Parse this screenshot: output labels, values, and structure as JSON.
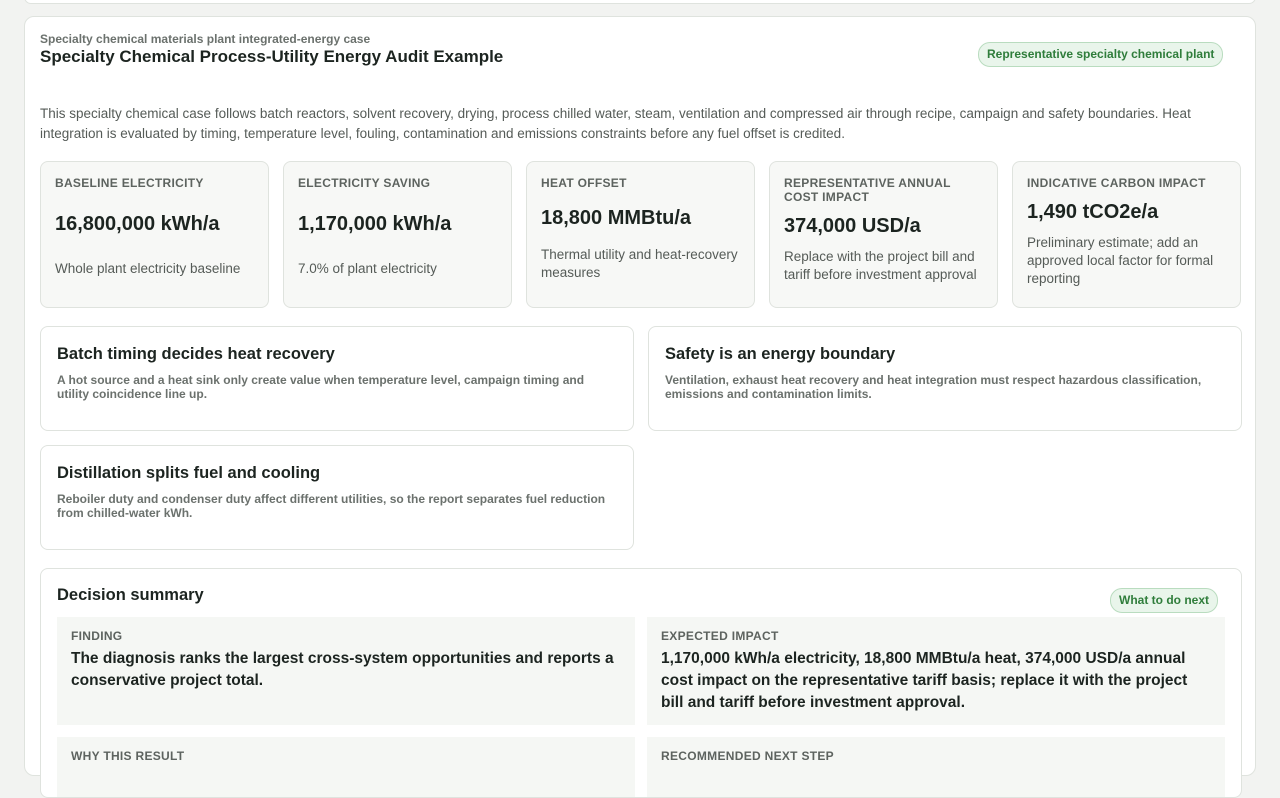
{
  "header": {
    "eyebrow": "Specialty chemical materials plant integrated-energy case",
    "title": "Specialty Chemical Process-Utility Energy Audit Example",
    "badge": "Representative specialty chemical plant"
  },
  "intro": "This specialty chemical case follows batch reactors, solvent recovery, drying, process chilled water, steam, ventilation and compressed air through recipe, campaign and safety boundaries. Heat integration is evaluated by timing, temperature level, fouling, contamination and emissions constraints before any fuel offset is credited.",
  "metrics": [
    {
      "label": "BASELINE ELECTRICITY",
      "value": "16,800,000 kWh/a",
      "desc": "Whole plant electricity baseline"
    },
    {
      "label": "ELECTRICITY SAVING",
      "value": "1,170,000 kWh/a",
      "desc": "7.0% of plant electricity"
    },
    {
      "label": "HEAT OFFSET",
      "value": "18,800 MMBtu/a",
      "desc": "Thermal utility and heat-recovery measures"
    },
    {
      "label": "REPRESENTATIVE ANNUAL COST IMPACT",
      "value": "374,000 USD/a",
      "desc": "Replace with the project bill and tariff before investment approval"
    },
    {
      "label": "INDICATIVE CARBON IMPACT",
      "value": "1,490 tCO2e/a",
      "desc": "Preliminary estimate; add an approved local factor for formal reporting"
    }
  ],
  "insights": [
    {
      "title": "Batch timing decides heat recovery",
      "text": "A hot source and a heat sink only create value when temperature level, campaign timing and utility coincidence line up."
    },
    {
      "title": "Safety is an energy boundary",
      "text": "Ventilation, exhaust heat recovery and heat integration must respect hazardous classification, emissions and contamination limits."
    },
    {
      "title": "Distillation splits fuel and cooling",
      "text": "Reboiler duty and condenser duty affect different utilities, so the report separates fuel reduction from chilled-water kWh."
    }
  ],
  "decision": {
    "title": "Decision summary",
    "badge": "What to do next",
    "finding_label": "FINDING",
    "finding_text": "The diagnosis ranks the largest cross-system opportunities and reports a conservative project total.",
    "impact_label": "EXPECTED IMPACT",
    "impact_text": "1,170,000 kWh/a electricity, 18,800 MMBtu/a heat, 374,000 USD/a annual cost impact on the representative tariff basis; replace it with the project bill and tariff before investment approval.",
    "why_label": "WHY THIS RESULT",
    "next_label": "RECOMMENDED NEXT STEP"
  }
}
